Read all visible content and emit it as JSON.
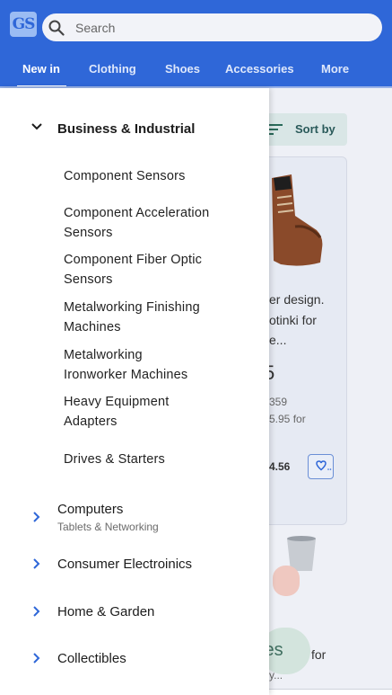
{
  "header": {
    "logo": "GS",
    "search_placeholder": "Search",
    "tabs": [
      "New in",
      "Clothing",
      "Shoes",
      "Accessories",
      "More"
    ]
  },
  "background": {
    "sort_label": "Sort by",
    "desc_lines": [
      "er design.",
      "otinki for",
      "e..."
    ],
    "price_partial": "5",
    "old_price": "359",
    "shipping_partial": "5.95 for",
    "price2_partial": "4.56",
    "lower_pill": "ies",
    "lower_text": "for",
    "lower_text2": "y..."
  },
  "drawer": {
    "expanded_category": "Business & Industrial",
    "subcategories": [
      "Component Sensors",
      "Component Acceleration Sensors",
      "Component Fiber Optic Sensors",
      "Metalworking Finishing Machines",
      "Metalworking Ironworker Machines",
      "Heavy Equipment Adapters",
      "Drives & Starters"
    ],
    "categories": [
      {
        "title": "Computers",
        "subtitle": "Tablets & Networking"
      },
      {
        "title": "Consumer Electroinics"
      },
      {
        "title": "Home & Garden"
      },
      {
        "title": "Collectibles"
      }
    ]
  },
  "colors": {
    "header_bg": "#2f67d8",
    "accent": "#2f67d8",
    "chevron": "#2f67d8"
  }
}
